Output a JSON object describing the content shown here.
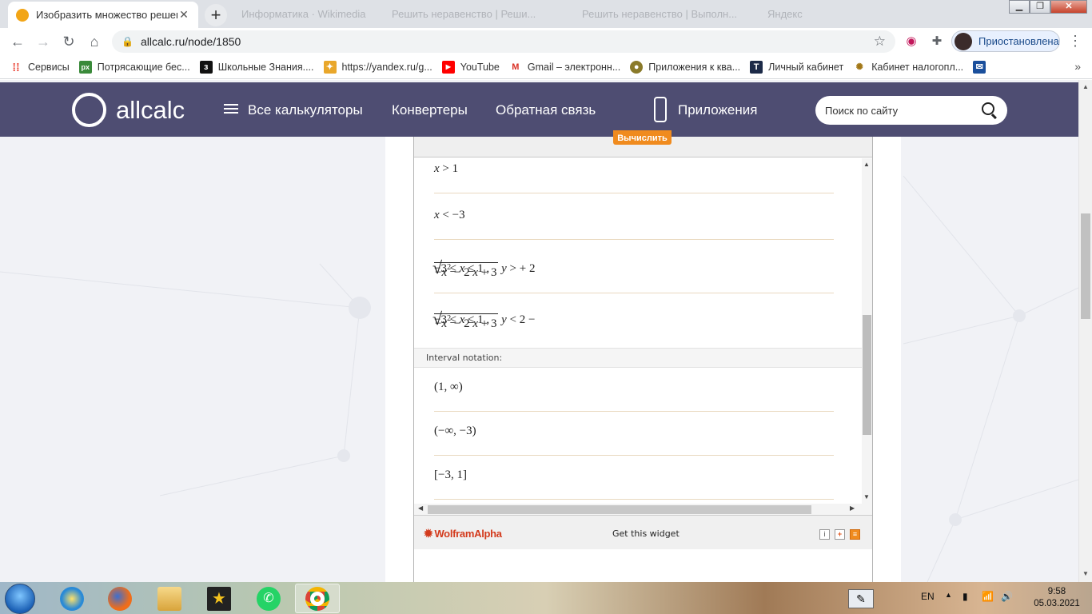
{
  "browser": {
    "tabs": [
      {
        "title": "Изобразить множество решени",
        "active": true
      },
      {
        "title": "Информатика · Wikimedia",
        "active": false
      },
      {
        "title": "Решить неравенство | Реши...",
        "active": false
      },
      {
        "title": "Решить неравенство | Выполн...",
        "active": false
      },
      {
        "title": "Яндекс",
        "active": false
      }
    ],
    "url": "allcalc.ru/node/1850",
    "profile_label": "Приостановлена"
  },
  "bookmarks": [
    {
      "label": "Сервисы",
      "icon": "apps-grid-icon",
      "color": "#ea4335"
    },
    {
      "label": "Потрясающие бес...",
      "icon": "px-icon",
      "color": "#3a8a3a"
    },
    {
      "label": "Школьные Знания....",
      "icon": "znaniya-icon",
      "color": "#111111"
    },
    {
      "label": "https://yandex.ru/g...",
      "icon": "game-icon",
      "color": "#e9a72b"
    },
    {
      "label": "YouTube",
      "icon": "youtube-icon",
      "color": "#ff0000"
    },
    {
      "label": "Gmail – электронн...",
      "icon": "gmail-icon",
      "color": "#d93025"
    },
    {
      "label": "Приложения к ква...",
      "icon": "emblem-icon",
      "color": "#8a7a2a"
    },
    {
      "label": "Личный кабинет",
      "icon": "tinkoff-icon",
      "color": "#1c2a48"
    },
    {
      "label": "Кабинет налогопл...",
      "icon": "nalog-icon",
      "color": "#a27716"
    }
  ],
  "site": {
    "logo_text": "allcalc",
    "nav": {
      "all_calcs": "Все калькуляторы",
      "converters": "Конвертеры",
      "feedback": "Обратная связь",
      "apps": "Приложения"
    },
    "search_placeholder": "Поиск по сайту"
  },
  "widget": {
    "compute_label": "Вычислить",
    "interval_heading": "Interval notation:",
    "get_widget": "Get this widget",
    "brand": "WolframAlpha"
  },
  "colors": {
    "header_bg": "#4e4d72",
    "accent_orange": "#f08b1e",
    "wa_red": "#d33a1c"
  },
  "taskbar": {
    "lang": "EN",
    "time": "9:58",
    "date": "05.03.2021"
  }
}
